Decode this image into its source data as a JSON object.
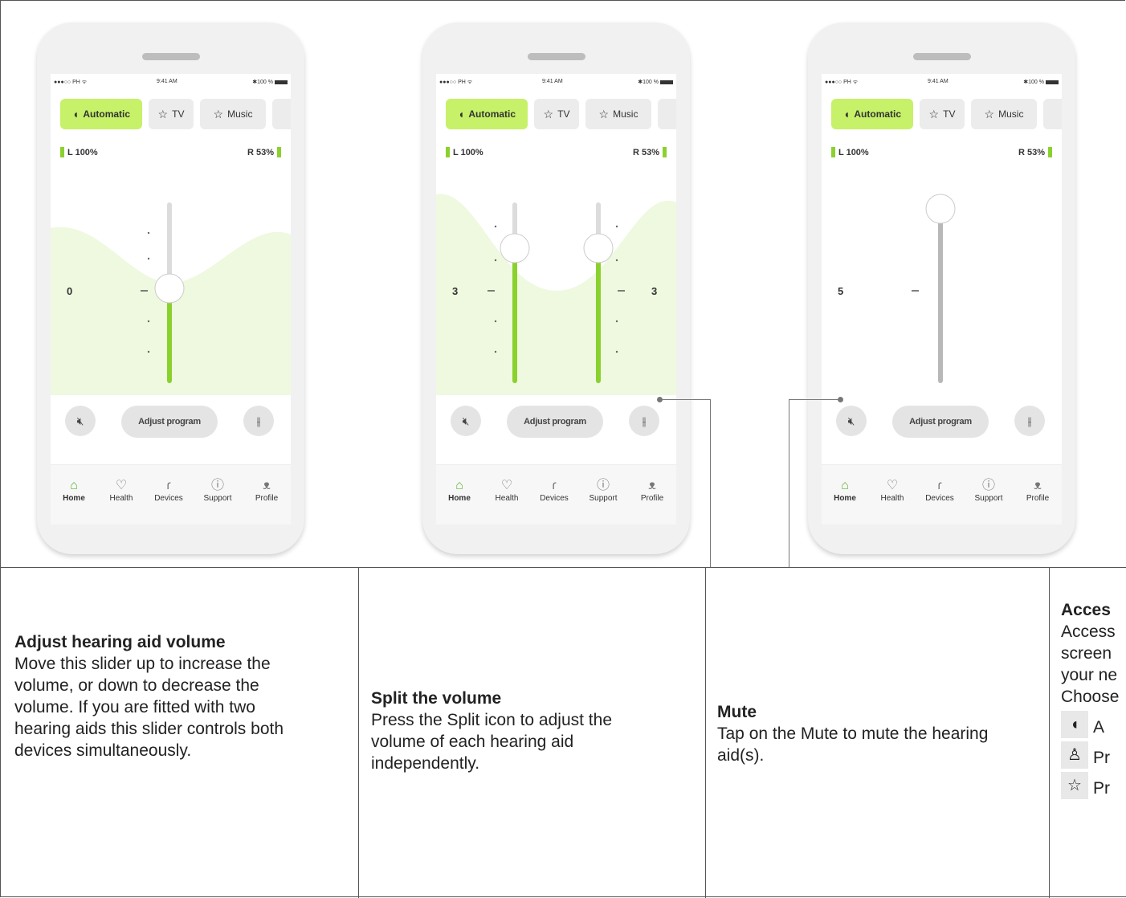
{
  "phone": {
    "status_left": "●●●○○ PH ᯤ",
    "status_time": "9:41 AM",
    "status_right": "✱100 %",
    "tabs": [
      {
        "label": "Automatic",
        "icon": "ear-icon"
      },
      {
        "label": "TV",
        "icon": "star-icon"
      },
      {
        "label": "Music",
        "icon": "star-icon"
      }
    ],
    "battery_left": "L 100%",
    "battery_right": "R 53%",
    "adjust_program_label": "Adjust program",
    "nav": [
      {
        "label": "Home",
        "icon": "home-icon"
      },
      {
        "label": "Health",
        "icon": "heart-icon"
      },
      {
        "label": "Devices",
        "icon": "hearing-aid-icon"
      },
      {
        "label": "Support",
        "icon": "help-icon"
      },
      {
        "label": "Profile",
        "icon": "user-icon"
      }
    ],
    "accent_color": "#c6f168",
    "slider_color": "#8bd12e"
  },
  "screens": [
    {
      "volume": "0"
    },
    {
      "volume_left": "3",
      "volume_right": "3"
    },
    {
      "volume": "5"
    }
  ],
  "cells": [
    {
      "title": "Adjust hearing aid volume",
      "body": "Move this slider up to increase the volume, or down to decrease the volume. If you are fitted with two hearing aids this slider controls both devices simultaneously."
    },
    {
      "title": "Split the volume",
      "body": "Press the Split icon to adjust the volume of each hearing aid independently."
    },
    {
      "title": "Mute",
      "body": "Tap on the Mute to mute the hearing aid(s)."
    },
    {
      "title": "Acces",
      "lines": [
        "Access",
        "screen",
        "your ne",
        "Choose"
      ],
      "items": [
        "A",
        "Pr",
        "Pr"
      ]
    }
  ]
}
